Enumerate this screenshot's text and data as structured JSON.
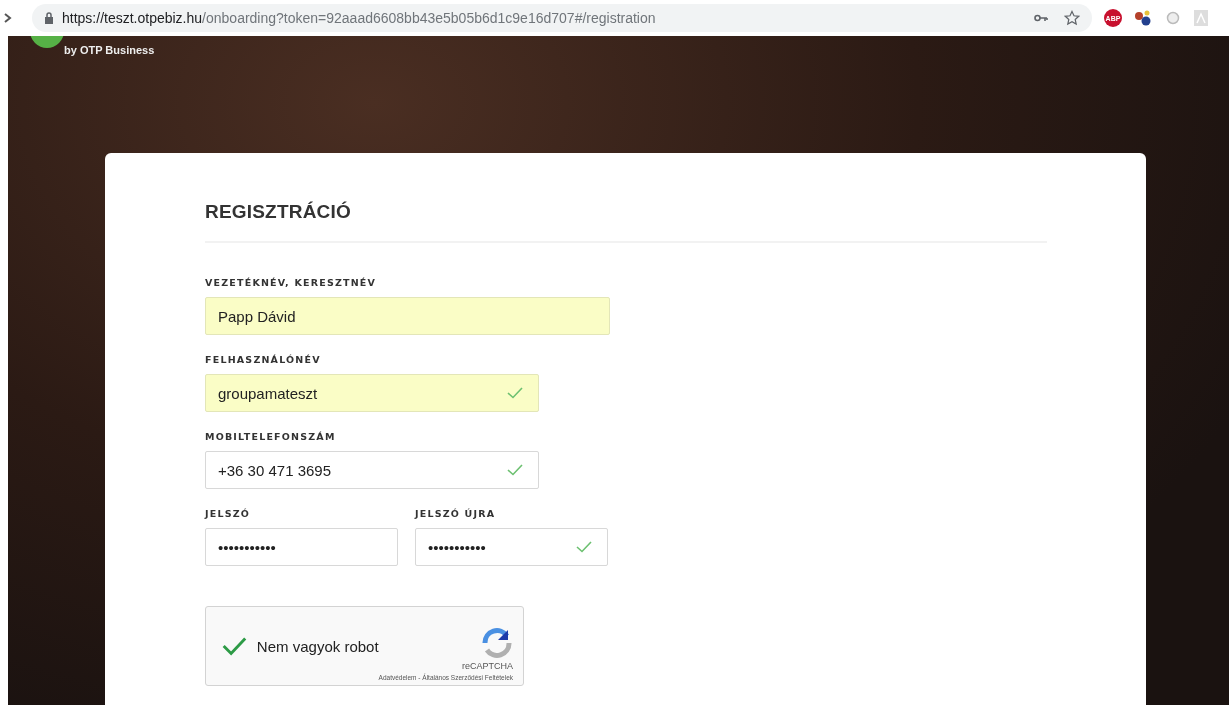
{
  "browser": {
    "url_host": "https://teszt.otpebiz.hu",
    "url_path": "/onboarding?token=92aaad6608bb43e5b05b6d1c9e16d707#/registration",
    "extension_badge": "ABP"
  },
  "header": {
    "logo_caption": "by OTP Business"
  },
  "form": {
    "title": "REGISZTRÁCIÓ",
    "rows": [
      [
        {
          "label": "VEZETÉKNÉV, KERESZTNÉV",
          "value": "Papp Dávid",
          "autofilled": true,
          "valid": false
        }
      ],
      [
        {
          "label": "FELHASZNÁLÓNÉV",
          "value": "groupamateszt",
          "autofilled": true,
          "valid": true
        }
      ],
      [
        {
          "label": "MOBILTELEFONSZÁM",
          "value": "+36 30 471 3695",
          "autofilled": false,
          "valid": true
        }
      ],
      [
        {
          "label": "JELSZÓ",
          "value": "•••••••••••",
          "autofilled": false,
          "valid": false
        },
        {
          "label": "JELSZÓ ÚJRA",
          "value": "•••••••••••",
          "autofilled": false,
          "valid": true
        }
      ]
    ],
    "captcha": {
      "label": "Nem vagyok robot",
      "checked": true,
      "brand": "reCAPTCHA",
      "links": "Adatvédelem - Általános Szerződési Feltételek"
    }
  }
}
